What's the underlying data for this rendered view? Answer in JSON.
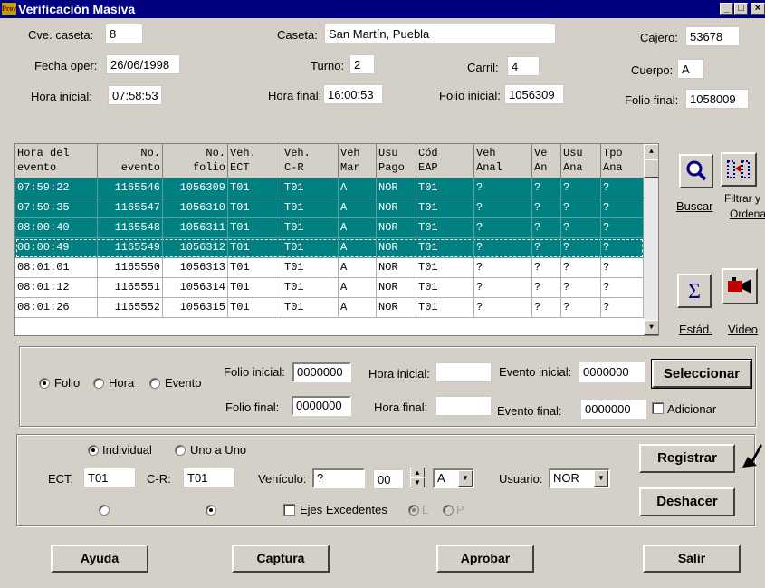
{
  "window": {
    "title": "Verificación Masiva",
    "icon_text": "Prov",
    "controls": [
      "minimize-icon",
      "maximize-icon",
      "close-icon"
    ]
  },
  "header": {
    "cve_caseta_label": "Cve. caseta:",
    "cve_caseta_value": "8",
    "caseta_label": "Caseta:",
    "caseta_value": "San Martín, Puebla",
    "cajero_label": "Cajero:",
    "cajero_value": "53678",
    "fecha_label": "Fecha oper:",
    "fecha_value": "26/06/1998",
    "turno_label": "Turno:",
    "turno_value": "2",
    "carril_label": "Carril:",
    "carril_value": "4",
    "cuerpo_label": "Cuerpo:",
    "cuerpo_value": "A",
    "hora_inicial_label": "Hora inicial:",
    "hora_inicial_value": "07:58:53",
    "hora_final_label": "Hora final:",
    "hora_final_value": "16:00:53",
    "folio_inicial_label": "Folio inicial:",
    "folio_inicial_value": "1056309",
    "folio_final_label": "Folio final:",
    "folio_final_value": "1058009"
  },
  "grid": {
    "columns": [
      {
        "l1": "Hora del",
        "l2": "evento"
      },
      {
        "l1": "No.",
        "l2": "evento"
      },
      {
        "l1": "No.",
        "l2": "folio"
      },
      {
        "l1": "Veh.",
        "l2": "ECT"
      },
      {
        "l1": "Veh.",
        "l2": "C-R"
      },
      {
        "l1": "Veh",
        "l2": "Mar"
      },
      {
        "l1": "Usu",
        "l2": "Pago"
      },
      {
        "l1": "Cód",
        "l2": "EAP"
      },
      {
        "l1": "Veh",
        "l2": "Anal"
      },
      {
        "l1": "Ve",
        "l2": "An"
      },
      {
        "l1": "Usu",
        "l2": "Ana"
      },
      {
        "l1": "Tpo",
        "l2": "Ana"
      }
    ],
    "rows": [
      {
        "selected": true,
        "cells": [
          "07:59:22",
          "1165546",
          "1056309",
          "T01",
          "T01",
          "A",
          "NOR",
          "T01",
          "?",
          "?",
          "?",
          "?"
        ]
      },
      {
        "selected": true,
        "cells": [
          "07:59:35",
          "1165547",
          "1056310",
          "T01",
          "T01",
          "A",
          "NOR",
          "T01",
          "?",
          "?",
          "?",
          "?"
        ]
      },
      {
        "selected": true,
        "cells": [
          "08:00:40",
          "1165548",
          "1056311",
          "T01",
          "T01",
          "A",
          "NOR",
          "T01",
          "?",
          "?",
          "?",
          "?"
        ]
      },
      {
        "selected": true,
        "focused": true,
        "cells": [
          "08:00:49",
          "1165549",
          "1056312",
          "T01",
          "T01",
          "A",
          "NOR",
          "T01",
          "?",
          "?",
          "?",
          "?"
        ]
      },
      {
        "selected": false,
        "cells": [
          "08:01:01",
          "1165550",
          "1056313",
          "T01",
          "T01",
          "A",
          "NOR",
          "T01",
          "?",
          "?",
          "?",
          "?"
        ]
      },
      {
        "selected": false,
        "cells": [
          "08:01:12",
          "1165551",
          "1056314",
          "T01",
          "T01",
          "A",
          "NOR",
          "T01",
          "?",
          "?",
          "?",
          "?"
        ]
      },
      {
        "selected": false,
        "cells": [
          "08:01:26",
          "1165552",
          "1056315",
          "T01",
          "T01",
          "A",
          "NOR",
          "T01",
          "?",
          "?",
          "?",
          "?"
        ]
      }
    ]
  },
  "side_buttons": {
    "buscar": "Buscar",
    "filtrar_l1": "Filtrar y",
    "filtrar_l2": "Ordenar",
    "estad": "Estád.",
    "video": "Video"
  },
  "selection": {
    "radio_folio": "Folio",
    "radio_hora": "Hora",
    "radio_evento": "Evento",
    "folio_inicial_label": "Folio inicial:",
    "folio_inicial_value": "0000000",
    "folio_final_label": "Folio final:",
    "folio_final_value": "0000000",
    "hora_inicial_label": "Hora inicial:",
    "hora_inicial_value": "",
    "hora_final_label": "Hora final:",
    "hora_final_value": "",
    "evento_inicial_label": "Evento inicial:",
    "evento_inicial_value": "0000000",
    "evento_final_label": "Evento final:",
    "evento_final_value": "0000000",
    "seleccionar_label": "Seleccionar",
    "adicionar_label": "Adicionar"
  },
  "register": {
    "individual_label": "Individual",
    "uno_a_uno_label": "Uno a Uno",
    "ect_label": "ECT:",
    "ect_value": "T01",
    "cr_label": "C-R:",
    "cr_value": "T01",
    "vehiculo_label": "Vehículo:",
    "vehiculo_value": "?",
    "ejes_value": "00",
    "marca_value": "A",
    "usuario_label": "Usuario:",
    "usuario_value": "NOR",
    "ejes_excedentes_label": "Ejes Excedentes",
    "radio_l": "L",
    "radio_p": "P",
    "registrar_label": "Registrar",
    "deshacer_label": "Deshacer"
  },
  "bottom": {
    "ayuda": "Ayuda",
    "captura": "Captura",
    "aprobar": "Aprobar",
    "salir": "Salir"
  }
}
